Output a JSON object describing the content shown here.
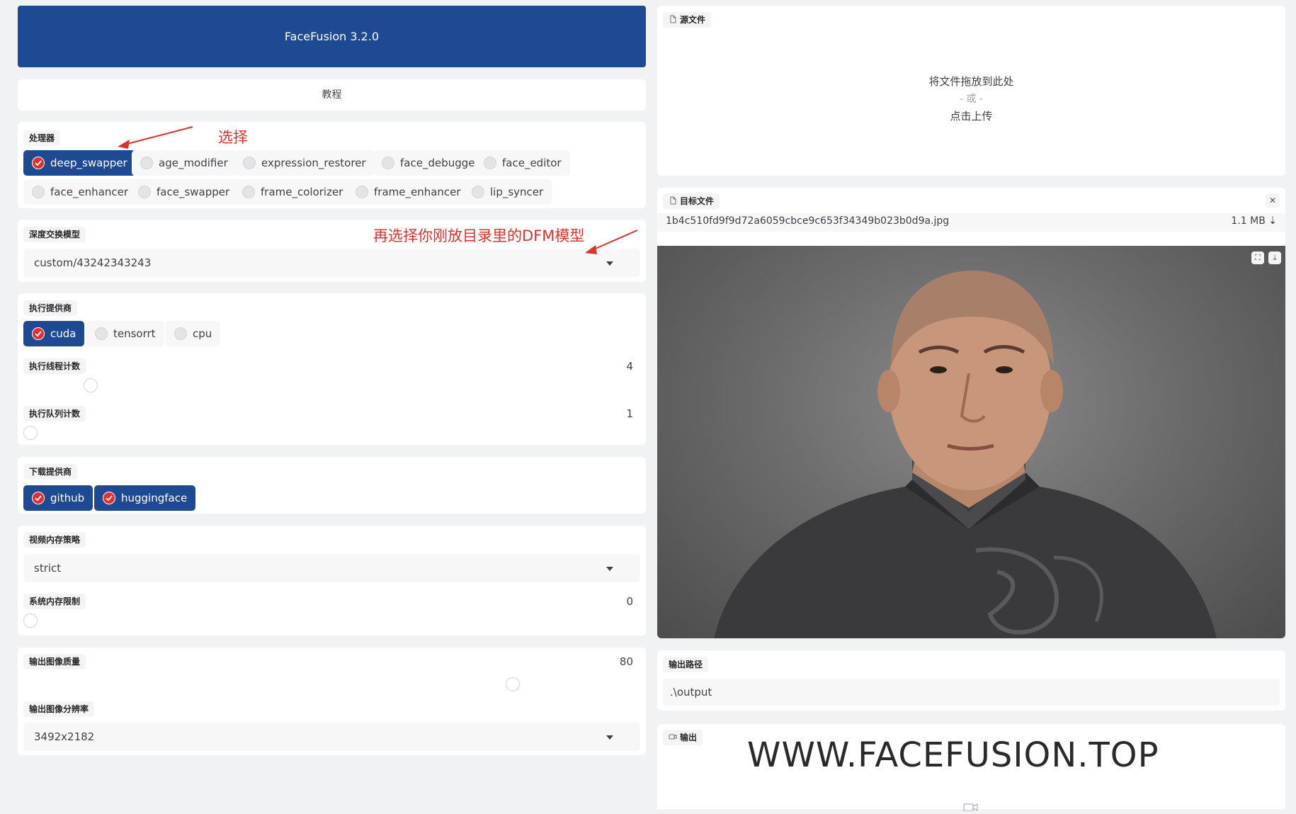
{
  "header": {
    "title": "FaceFusion 3.2.0"
  },
  "tutorial": {
    "label": "教程"
  },
  "processors": {
    "label": "处理器",
    "items": [
      {
        "label": "deep_swapper",
        "checked": true
      },
      {
        "label": "age_modifier",
        "checked": false
      },
      {
        "label": "expression_restorer",
        "checked": false
      },
      {
        "label": "face_debugger",
        "checked": false
      },
      {
        "label": "face_editor",
        "checked": false
      },
      {
        "label": "face_enhancer",
        "checked": false
      },
      {
        "label": "face_swapper",
        "checked": false
      },
      {
        "label": "frame_colorizer",
        "checked": false
      },
      {
        "label": "frame_enhancer",
        "checked": false
      },
      {
        "label": "lip_syncer",
        "checked": false
      }
    ]
  },
  "deep_swapper_model": {
    "label": "深度交换模型",
    "value": "custom/43242343243"
  },
  "execution": {
    "providers_label": "执行提供商",
    "providers": [
      {
        "label": "cuda",
        "checked": true
      },
      {
        "label": "tensorrt",
        "checked": false
      },
      {
        "label": "cpu",
        "checked": false
      }
    ],
    "thread_label": "执行线程计数",
    "thread_value": "4",
    "thread_fraction": 0.1,
    "queue_label": "执行队列计数",
    "queue_value": "1",
    "queue_fraction": 0.0
  },
  "download": {
    "label": "下载提供商",
    "providers": [
      {
        "label": "github",
        "checked": true
      },
      {
        "label": "huggingface",
        "checked": true
      }
    ]
  },
  "memory": {
    "video_strategy_label": "视频内存策略",
    "video_strategy_value": "strict",
    "system_limit_label": "系统内存限制",
    "system_limit_value": "0",
    "system_limit_fraction": 0.0
  },
  "output_image": {
    "quality_label": "输出图像质量",
    "quality_value": "80",
    "quality_fraction": 0.8,
    "resolution_label": "输出图像分辨率",
    "resolution_value": "3492x2182"
  },
  "source": {
    "label": "源文件",
    "drop_text": "将文件拖放到此处",
    "or_text": "- 或 -",
    "upload_text": "点击上传"
  },
  "target": {
    "label": "目标文件",
    "filename": "1b4c510fd9f9d72a6059cbce9c653f34349b023b0d9a.jpg",
    "filesize": "1.1 MB ⇣"
  },
  "output_path": {
    "label": "输出路径",
    "value": ".\\output"
  },
  "output": {
    "label": "输出",
    "watermark": "WWW.FACEFUSION.TOP"
  },
  "annotations": {
    "select": "选择",
    "select_model": "再选择你刚放目录里的DFM模型"
  },
  "colors": {
    "brand": "#1e4a94",
    "check": "#e03030",
    "annotation": "#e0312b"
  },
  "icons": [
    "file-icon",
    "close-icon",
    "fullscreen-icon",
    "download-icon",
    "video-icon",
    "caret-down-icon",
    "check-icon"
  ]
}
